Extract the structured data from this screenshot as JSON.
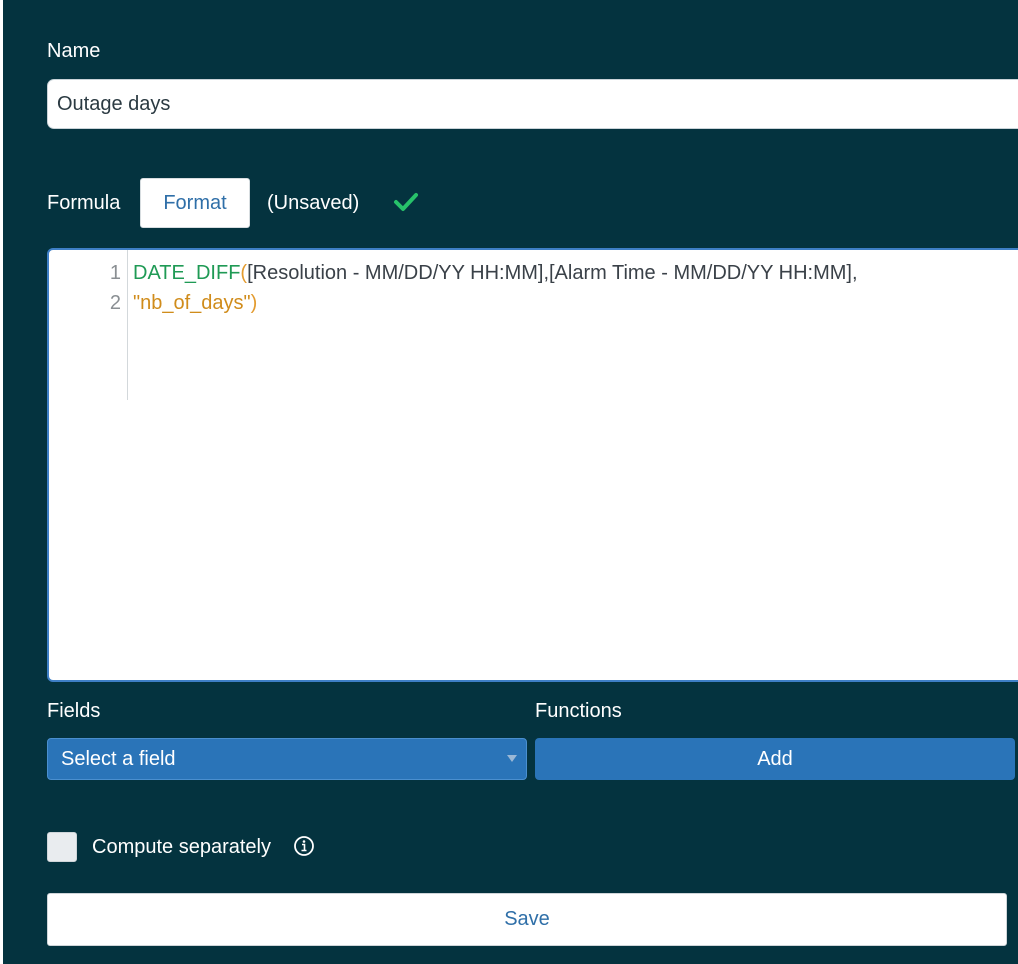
{
  "name_section": {
    "label": "Name",
    "value": "Outage days"
  },
  "formula_section": {
    "label": "Formula",
    "format_button": "Format",
    "status": "(Unsaved)",
    "status_icon": "check-icon",
    "status_color": "#27c26a"
  },
  "editor": {
    "line_numbers": [
      "1",
      "2"
    ],
    "line1": {
      "fn": "DATE_DIFF",
      "open_paren": "(",
      "args": "[Resolution - MM/DD/YY  HH:MM],[Alarm Time - MM/DD/YY  HH:MM],"
    },
    "line2": {
      "str": "\"nb_of_days\"",
      "close_paren": ")"
    }
  },
  "fields": {
    "label": "Fields",
    "select_value": "Select a field"
  },
  "functions": {
    "label": "Functions",
    "add_button": "Add"
  },
  "compute": {
    "label": "Compute separately",
    "checked": false,
    "info_icon": "info-icon"
  },
  "save_button": "Save",
  "colors": {
    "background": "#04333f",
    "primary": "#2a74b8",
    "link_text": "#2f6fa8"
  }
}
